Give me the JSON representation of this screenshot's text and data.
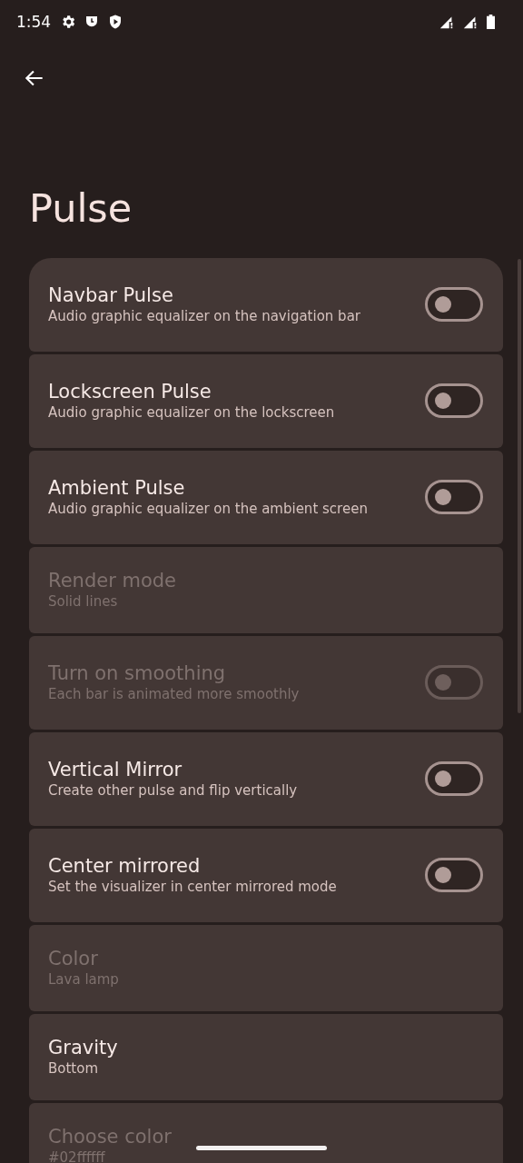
{
  "status_bar": {
    "time": "1:54"
  },
  "title": "Pulse",
  "items": [
    {
      "kind": "switch",
      "title": "Navbar Pulse",
      "summary": "Audio graphic equalizer on the navigation bar",
      "on": false,
      "disabled": false
    },
    {
      "kind": "switch",
      "title": "Lockscreen Pulse",
      "summary": "Audio graphic equalizer on the lockscreen",
      "on": false,
      "disabled": false
    },
    {
      "kind": "switch",
      "title": "Ambient Pulse",
      "summary": "Audio graphic equalizer on the ambient screen",
      "on": false,
      "disabled": false
    },
    {
      "kind": "plain",
      "title": "Render mode",
      "summary": "Solid lines",
      "disabled": true
    },
    {
      "kind": "switch",
      "title": "Turn on smoothing",
      "summary": "Each bar is animated more smoothly",
      "on": false,
      "disabled": true
    },
    {
      "kind": "switch",
      "title": "Vertical Mirror",
      "summary": "Create other pulse and flip vertically",
      "on": false,
      "disabled": false
    },
    {
      "kind": "switch",
      "title": "Center mirrored",
      "summary": "Set the visualizer in center mirrored mode",
      "on": false,
      "disabled": false
    },
    {
      "kind": "plain",
      "title": "Color",
      "summary": "Lava lamp",
      "disabled": true
    },
    {
      "kind": "plain",
      "title": "Gravity",
      "summary": "Bottom",
      "disabled": false
    },
    {
      "kind": "plain",
      "title": "Choose color",
      "summary": "#02ffffff",
      "disabled": true
    }
  ]
}
